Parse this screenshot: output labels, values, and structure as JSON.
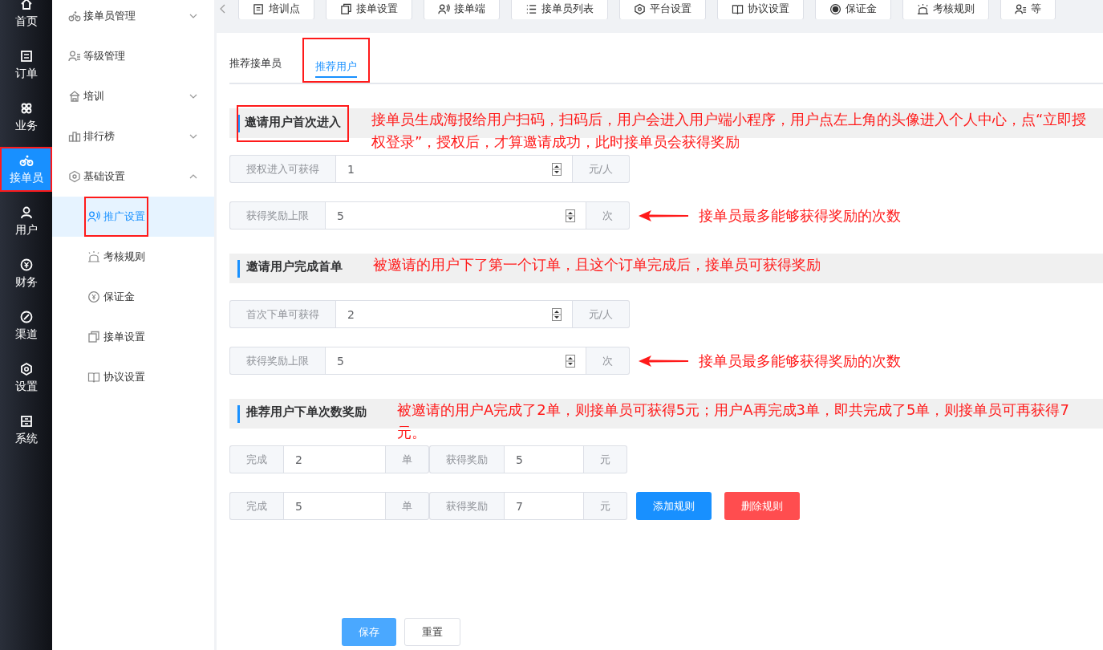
{
  "rail": [
    {
      "label": "首页",
      "selected": false,
      "highlighted": false
    },
    {
      "label": "订单",
      "selected": false,
      "highlighted": false
    },
    {
      "label": "业务",
      "selected": false,
      "highlighted": false
    },
    {
      "label": "接单员",
      "selected": true,
      "highlighted": true
    },
    {
      "label": "用户",
      "selected": false,
      "highlighted": false
    },
    {
      "label": "财务",
      "selected": false,
      "highlighted": false
    },
    {
      "label": "渠道",
      "selected": false,
      "highlighted": false
    },
    {
      "label": "设置",
      "selected": false,
      "highlighted": false
    },
    {
      "label": "系统",
      "selected": false,
      "highlighted": false
    }
  ],
  "menu": [
    {
      "label": "接单员管理",
      "expanded": false
    },
    {
      "label": "等级管理"
    },
    {
      "label": "培训",
      "expanded": false
    },
    {
      "label": "排行榜",
      "expanded": false
    },
    {
      "label": "基础设置",
      "expanded": true,
      "children": [
        {
          "label": "推广设置",
          "selected": true,
          "highlighted": true
        },
        {
          "label": "考核规则",
          "selected": false,
          "highlighted": false
        },
        {
          "label": "保证金",
          "selected": false,
          "highlighted": false
        },
        {
          "label": "接单设置",
          "selected": false,
          "highlighted": false
        },
        {
          "label": "协议设置",
          "selected": false,
          "highlighted": false
        }
      ]
    }
  ],
  "top_tabs": [
    "培训点",
    "接单设置",
    "接单端",
    "接单员列表",
    "平台设置",
    "协议设置",
    "保证金",
    "考核规则",
    "等"
  ],
  "tabs": [
    {
      "label": "推荐接单员",
      "selected": false,
      "highlighted": false
    },
    {
      "label": "推荐用户",
      "selected": true,
      "highlighted": true
    }
  ],
  "sections": [
    {
      "title": "邀请用户首次进入",
      "highlighted": true,
      "note": "接单员生成海报给用户扫码，扫码后，用户会进入用户端小程序，用户点左上角的头像进入个人中心，点“立即授权登录”，授权后，才算邀请成功，此时接单员会获得奖励",
      "fields": [
        {
          "label": "授权进入可获得",
          "value": "1",
          "unit": "元/人"
        },
        {
          "label": "获得奖励上限",
          "value": "5",
          "unit": "次",
          "note": "接单员最多能够获得奖励的次数"
        }
      ]
    },
    {
      "title": "邀请用户完成首单",
      "highlighted": false,
      "note": "被邀请的用户下了第一个订单，且这个订单完成后，接单员可获得奖励",
      "fields": [
        {
          "label": "首次下单可获得",
          "value": "2",
          "unit": "元/人"
        },
        {
          "label": "获得奖励上限",
          "value": "5",
          "unit": "次",
          "note": "接单员最多能够获得奖励的次数"
        }
      ]
    },
    {
      "title": "推荐用户下单次数奖励",
      "highlighted": false,
      "note": "被邀请的用户A完成了2单，则接单员可获得5元；用户A再完成3单，即共完成了5单，则接单员可再获得7元。",
      "rules": [
        {
          "done_label": "完成",
          "done_value": "2",
          "done_unit": "单",
          "reward_label": "获得奖励",
          "reward_value": "5",
          "reward_unit": "元"
        },
        {
          "done_label": "完成",
          "done_value": "5",
          "done_unit": "单",
          "reward_label": "获得奖励",
          "reward_value": "7",
          "reward_unit": "元"
        }
      ],
      "add_button": "添加规则",
      "delete_button": "删除规则"
    }
  ],
  "save_button": "保存",
  "reset_button": "重置"
}
